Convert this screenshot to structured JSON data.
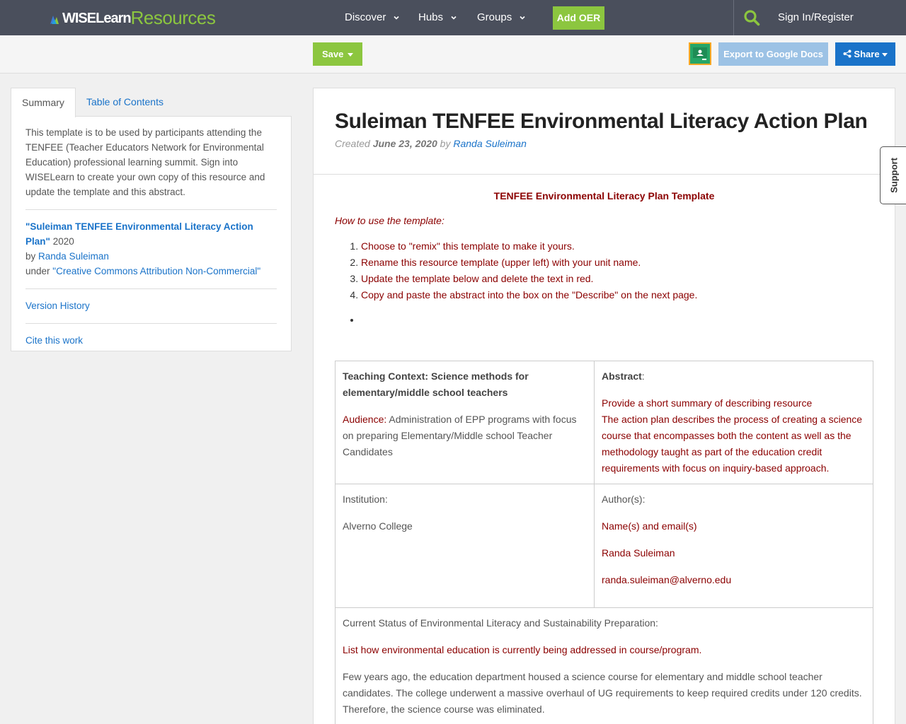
{
  "nav": {
    "logo_part1": "WISELearn",
    "logo_part2": "Resources",
    "items": [
      {
        "label": "Discover"
      },
      {
        "label": "Hubs"
      },
      {
        "label": "Groups"
      }
    ],
    "add_oer": "Add OER",
    "signin": "Sign In/Register"
  },
  "toolbar": {
    "save_label": "Save",
    "export_label": "Export to Google Docs",
    "share_label": "Share"
  },
  "sidebar": {
    "tabs": [
      "Summary",
      "Table of Contents"
    ],
    "abstract": "This template is to be used by participants attending the TENFEE (Teacher Educators Network for Environmental Education) professional learning summit. Sign into WISELearn to create your own copy of this resource and update the template and this abstract.",
    "attribution": {
      "title": "\"Suleiman TENFEE Environmental Literacy Action Plan\"",
      "year": "2020",
      "by": "by",
      "author": "Randa Suleiman",
      "under": "under",
      "license": "\"Creative Commons Attribution Non-Commercial\""
    },
    "version_history": "Version History",
    "cite": "Cite this work"
  },
  "resource": {
    "title": "Suleiman TENFEE Environmental Literacy Action Plan",
    "created_label": "Created",
    "date": "June 23, 2020",
    "by": "by",
    "author": "Randa Suleiman",
    "template_title": "TENFEE Environmental Literacy Plan Template",
    "howto": "How to use the template:",
    "steps": [
      "Choose to \"remix\" this template to make it yours.",
      "Rename this resource template (upper left) with your unit name.",
      "Update the template below and delete the text in red.",
      "Copy and paste the abstract into the box on the \"Describe\" on the next page."
    ],
    "table": {
      "context_heading": "Teaching Context: Science methods for elementary/middle school teachers",
      "audience_label": "Audience:",
      "audience_text": " Administration of EPP programs with focus on preparing Elementary/Middle school Teacher Candidates",
      "abstract_label": "Abstract",
      "abstract_colon": ":",
      "abstract_hint": "Provide a short summary of describing resource",
      "abstract_text": "The action plan describes the process of creating a science course that encompasses both the content as well as the methodology taught as part of the education credit requirements with focus on inquiry-based approach.",
      "institution_label": "Institution:",
      "institution_value": "Alverno College",
      "authors_label": "Author(s):",
      "authors_hint": "Name(s) and email(s)",
      "author_name": "Randa Suleiman",
      "author_email": "randa.suleiman@alverno.edu",
      "status_label": "Current Status of Environmental Literacy and Sustainability Preparation:",
      "status_hint": "List how environmental education is currently being addressed in course/program.",
      "status_text": "Few years ago, the education department housed a science course for elementary and middle school teacher candidates. The college underwent a massive overhaul of UG requirements to keep required credits under 120 credits. Therefore, the science course was eliminated."
    }
  },
  "support_label": "Support"
}
